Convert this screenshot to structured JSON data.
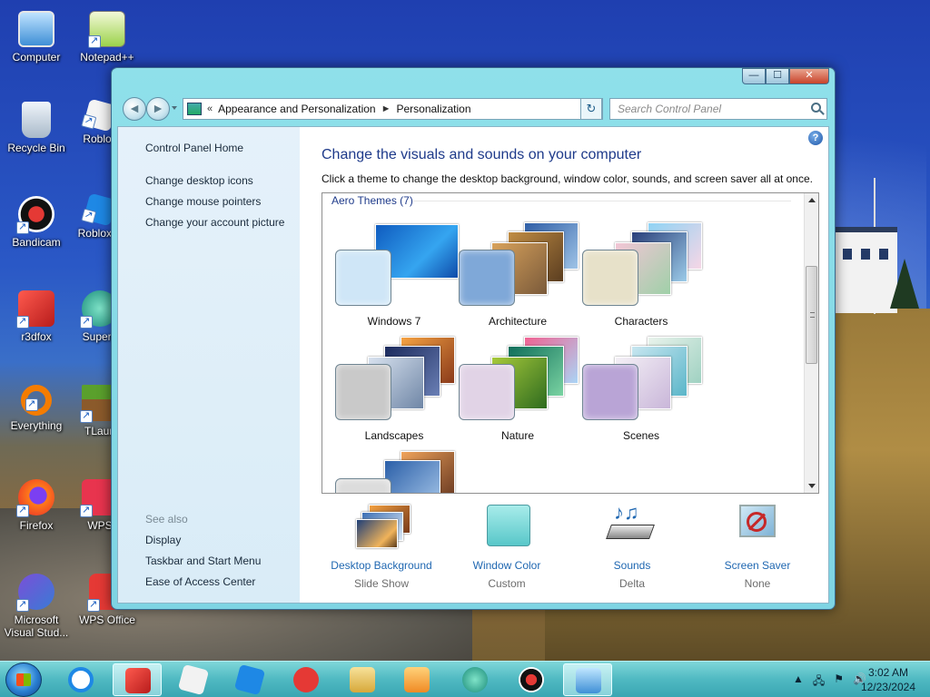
{
  "desktop": {
    "icons": [
      {
        "label": "Computer",
        "icon": "computer-icon"
      },
      {
        "label": "Notepad++",
        "icon": "notepadpp-icon"
      },
      {
        "label": "Recycle Bin",
        "icon": "recycle-bin-icon"
      },
      {
        "label": "Roblox",
        "icon": "roblox-icon"
      },
      {
        "label": "Bandicam",
        "icon": "bandicam-icon"
      },
      {
        "label": "Roblox S",
        "icon": "roblox-studio-icon"
      },
      {
        "label": "r3dfox",
        "icon": "r3dfox-icon"
      },
      {
        "label": "Supern",
        "icon": "supern-icon"
      },
      {
        "label": "Everything",
        "icon": "everything-icon"
      },
      {
        "label": "TLaun",
        "icon": "tlauncher-icon"
      },
      {
        "label": "Firefox",
        "icon": "firefox-icon"
      },
      {
        "label": "WPS",
        "icon": "wps-icon"
      },
      {
        "label": "Microsoft Visual Stud...",
        "icon": "visual-studio-icon"
      },
      {
        "label": "WPS Office",
        "icon": "wps-office-icon"
      }
    ]
  },
  "window": {
    "caption_buttons": {
      "minimize": "—",
      "maximize": "☐",
      "close": "✕"
    },
    "nav": {
      "back_icon": "back-arrow-icon",
      "forward_icon": "forward-arrow-icon",
      "back_glyph": "◄",
      "forward_glyph": "►"
    },
    "address": {
      "prefix": "«",
      "crumbs": [
        "Appearance and Personalization",
        "Personalization"
      ],
      "separator": "►",
      "refresh_glyph": "↻"
    },
    "search": {
      "placeholder": "Search Control Panel"
    },
    "left_pane": {
      "home": "Control Panel Home",
      "links": [
        "Change desktop icons",
        "Change mouse pointers",
        "Change your account picture"
      ],
      "see_also_label": "See also",
      "see_also": [
        "Display",
        "Taskbar and Start Menu",
        "Ease of Access Center"
      ]
    },
    "main": {
      "help_glyph": "?",
      "heading": "Change the visuals and sounds on your computer",
      "subtext": "Click a theme to change the desktop background, window color, sounds, and screen saver all at once.",
      "group_label": "Aero Themes (7)",
      "themes": [
        {
          "name": "Windows 7",
          "swatch": "#cfe6f7"
        },
        {
          "name": "Architecture",
          "swatch": "#7fa8d8"
        },
        {
          "name": "Characters",
          "swatch": "#e7e1c9"
        },
        {
          "name": "Landscapes",
          "swatch": "#c9c9c9"
        },
        {
          "name": "Nature",
          "swatch": "#e1d3e6"
        },
        {
          "name": "Scenes",
          "swatch": "#b9a4d6"
        }
      ],
      "bottom_items": [
        {
          "label": "Desktop Background",
          "value": "Slide Show",
          "icon": "desktop-background-icon"
        },
        {
          "label": "Window Color",
          "value": "Custom",
          "icon": "window-color-icon"
        },
        {
          "label": "Sounds",
          "value": "Delta",
          "icon": "sounds-icon"
        },
        {
          "label": "Screen Saver",
          "value": "None",
          "icon": "screen-saver-icon"
        }
      ]
    }
  },
  "taskbar": {
    "items": [
      "r3dfox",
      "Internet Explorer",
      "Roblox",
      "Roblox Studio",
      "WPS Office",
      "File Explorer",
      "Media Player",
      "Supern",
      "Bandicam",
      "Control Panel"
    ],
    "tray": {
      "show_hidden": "▲",
      "network": "🖧",
      "flag": "⚑",
      "volume": "🔊"
    },
    "clock": {
      "time": "3:02 AM",
      "date": "12/23/2024"
    }
  },
  "colors": {
    "accent": "#1e3a8a",
    "link": "#1f67b1",
    "taskbar": "#4fb9c2",
    "window_frame": "#8fe0ea"
  }
}
